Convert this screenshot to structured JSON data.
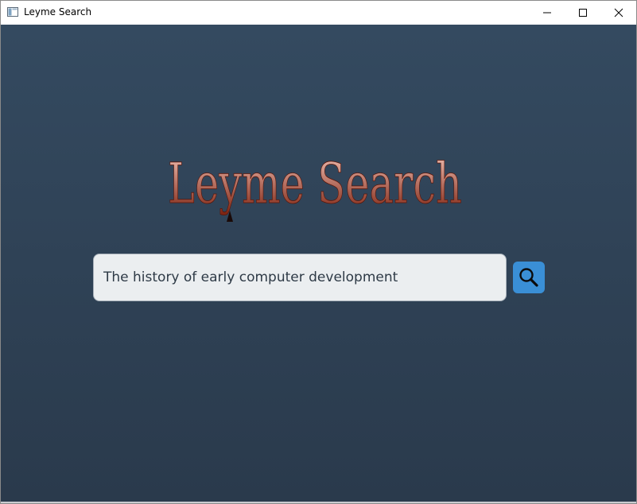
{
  "window": {
    "title": "Leyme Search",
    "icon": "window-app-icon",
    "controls": [
      "minimize-icon",
      "maximize-icon",
      "close-icon"
    ]
  },
  "logo": {
    "text": "Leyme Search",
    "colors": {
      "top": "#f4c4b8",
      "bottom": "#7a1f0c"
    }
  },
  "search": {
    "value": "The history of early computer development",
    "button_icon": "search-icon",
    "button_color": "#3a8fd6"
  },
  "theme": {
    "background_top": "#344a60",
    "background_bottom": "#2a3a4c"
  }
}
